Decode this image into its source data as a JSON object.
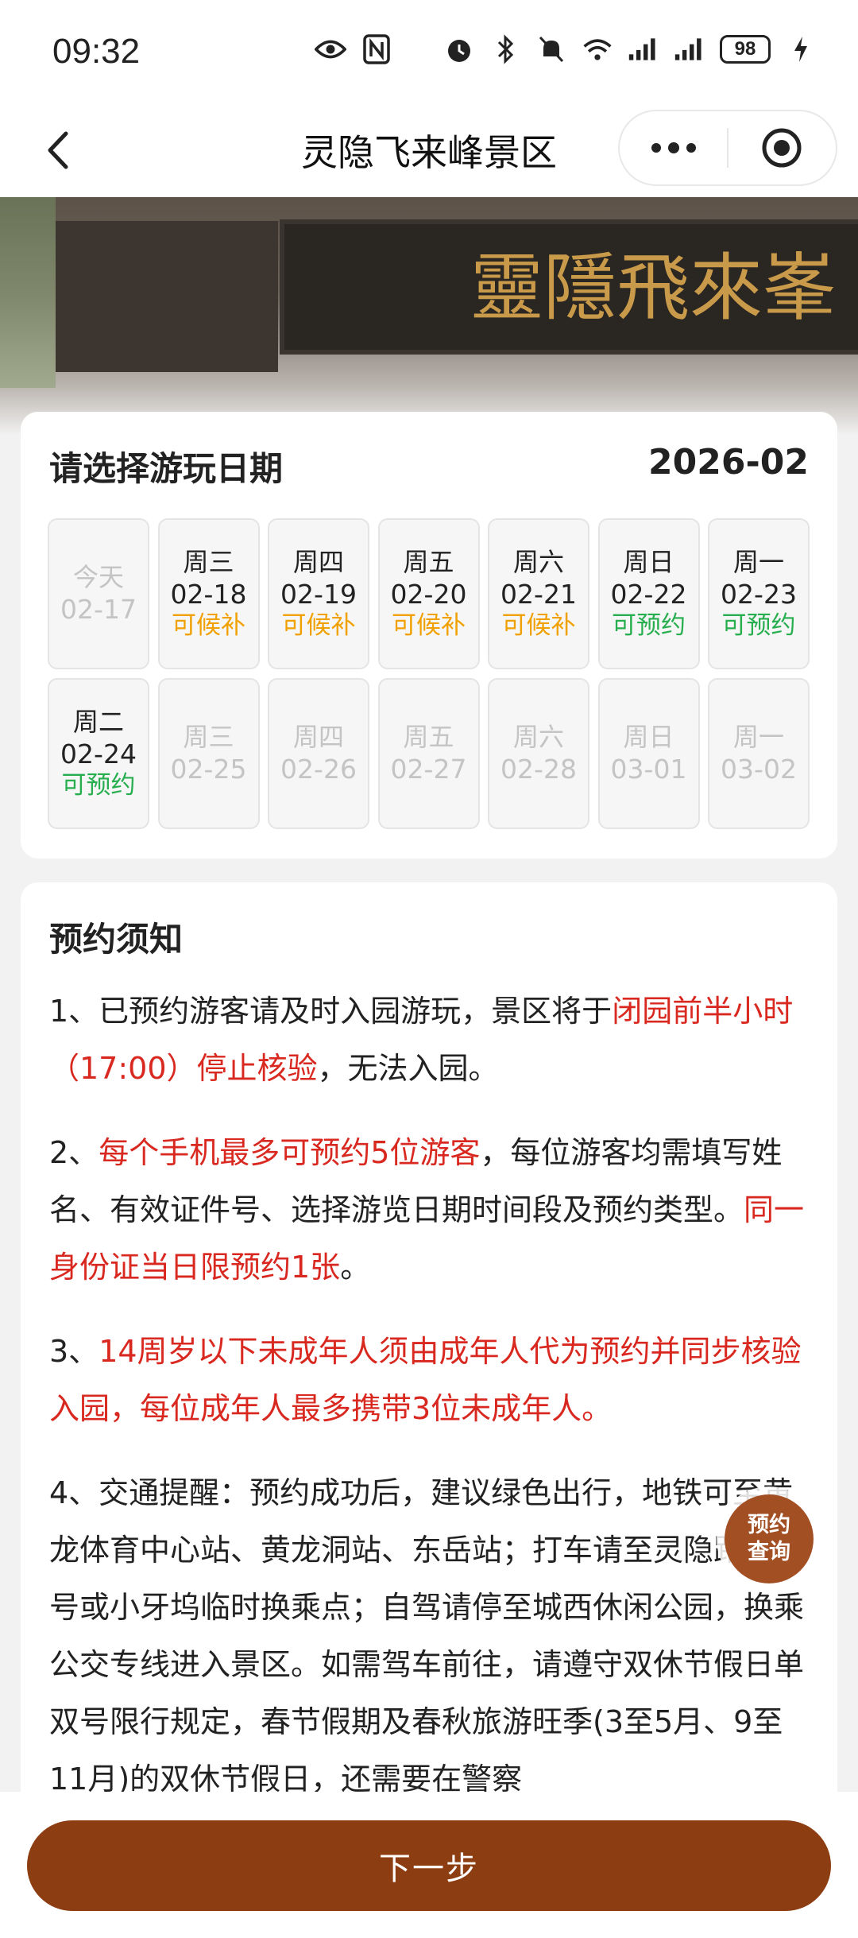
{
  "status_bar": {
    "time": "09:32",
    "battery": "98"
  },
  "nav": {
    "title": "灵隐飞来峰景区",
    "more_icon": "more-dots-icon",
    "close_icon": "target-circle-icon"
  },
  "banner": {
    "plaque_text": "靈隱飛來峯"
  },
  "date_picker": {
    "title": "请选择游玩日期",
    "month": "2026-02",
    "days": [
      {
        "weekday": "今天",
        "date": "02-17",
        "status": "",
        "state": "disabled"
      },
      {
        "weekday": "周三",
        "date": "02-18",
        "status": "可候补",
        "state": "waitlist"
      },
      {
        "weekday": "周四",
        "date": "02-19",
        "status": "可候补",
        "state": "waitlist"
      },
      {
        "weekday": "周五",
        "date": "02-20",
        "status": "可候补",
        "state": "waitlist"
      },
      {
        "weekday": "周六",
        "date": "02-21",
        "status": "可候补",
        "state": "waitlist"
      },
      {
        "weekday": "周日",
        "date": "02-22",
        "status": "可预约",
        "state": "available"
      },
      {
        "weekday": "周一",
        "date": "02-23",
        "status": "可预约",
        "state": "available"
      },
      {
        "weekday": "周二",
        "date": "02-24",
        "status": "可预约",
        "state": "available"
      },
      {
        "weekday": "周三",
        "date": "02-25",
        "status": "",
        "state": "disabled"
      },
      {
        "weekday": "周四",
        "date": "02-26",
        "status": "",
        "state": "disabled"
      },
      {
        "weekday": "周五",
        "date": "02-27",
        "status": "",
        "state": "disabled"
      },
      {
        "weekday": "周六",
        "date": "02-28",
        "status": "",
        "state": "disabled"
      },
      {
        "weekday": "周日",
        "date": "03-01",
        "status": "",
        "state": "disabled"
      },
      {
        "weekday": "周一",
        "date": "03-02",
        "status": "",
        "state": "disabled"
      }
    ]
  },
  "notice": {
    "title": "预约须知",
    "items": [
      [
        {
          "text": "1、已预约游客请及时入园游玩，景区将于",
          "red": false
        },
        {
          "text": "闭园前半小时（17:00）停止核验",
          "red": true
        },
        {
          "text": "，无法入园。",
          "red": false
        }
      ],
      [
        {
          "text": "2、",
          "red": false
        },
        {
          "text": "每个手机最多可预约5位游客",
          "red": true
        },
        {
          "text": "，每位游客均需填写姓名、有效证件号、选择游览日期时间段及预约类型。",
          "red": false
        },
        {
          "text": "同一身份证当日限预约1张",
          "red": true
        },
        {
          "text": "。",
          "red": false
        }
      ],
      [
        {
          "text": "3、",
          "red": false
        },
        {
          "text": "14周岁以下未成年人须由成年人代为预约并同步核验入园，每位成年人最多携带3位未成年人。",
          "red": true
        }
      ],
      [
        {
          "text": "4、交通提醒：预约成功后，建议绿色出行，地铁可至黄龙体育中心站、黄龙洞站、东岳站；打车请至灵隐路 608 号或小牙坞临时换乘点；自驾请停至城西休闲公园，换乘公交专线进入景区。如需驾车前往，请遵守双休节假日单双号限行规定，春节假期及春秋旅游旺季(3至5月、9至11月)的双休节假日，还需要在警察",
          "red": false
        }
      ]
    ]
  },
  "float_button": {
    "line1": "预约",
    "line2": "查询"
  },
  "footer": {
    "next_label": "下一步"
  },
  "colors": {
    "primary": "#8d3d12",
    "waitlist": "#f0a100",
    "available": "#27ae4f",
    "highlight_red": "#d9281f"
  }
}
